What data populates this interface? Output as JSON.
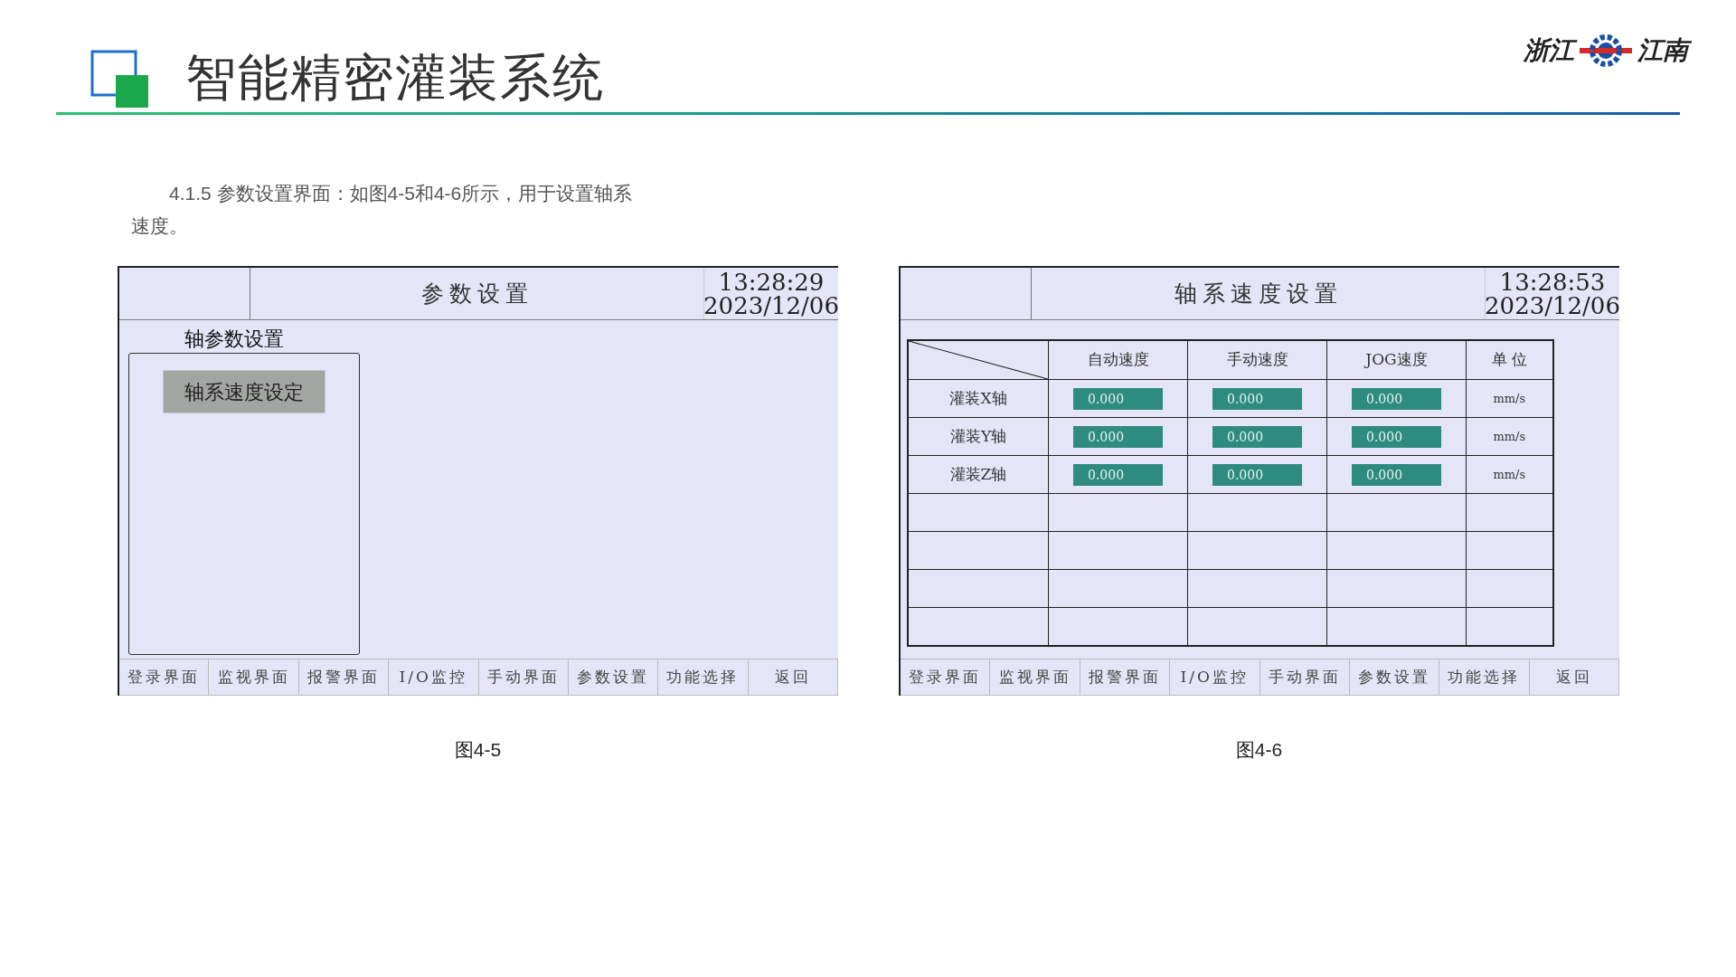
{
  "slide": {
    "title": "智能精密灌装系统",
    "logo": {
      "left_text": "浙江",
      "right_text": "江南"
    },
    "paragraph": "4.1.5  参数设置界面：如图4-5和4-6所示，用于设置轴系速度。"
  },
  "figures": [
    {
      "caption": "图4-5",
      "screen": {
        "kind": "menu",
        "title": "参数设置",
        "time": "13:28:29",
        "date": "2023/12/06",
        "group_label": "轴参数设置",
        "menu_buttons": [
          {
            "label": "轴系速度设定",
            "selected": true
          }
        ],
        "footer_buttons": [
          "登录界面",
          "监视界面",
          "报警界面",
          "I/O监控",
          "手动界面",
          "参数设置",
          "功能选择",
          "返回"
        ]
      }
    },
    {
      "caption": "图4-6",
      "screen": {
        "kind": "table",
        "title": "轴系速度设置",
        "time": "13:28:53",
        "date": "2023/12/06",
        "table": {
          "columns": [
            "自动速度",
            "手动速度",
            "JOG速度",
            "单 位"
          ],
          "rows": [
            {
              "kind": "axis",
              "label": "灌装X轴",
              "values": [
                "0.000",
                "0.000",
                "0.000"
              ],
              "unit": "mm/s"
            },
            {
              "kind": "axis",
              "label": "灌装Y轴",
              "values": [
                "0.000",
                "0.000",
                "0.000"
              ],
              "unit": "mm/s"
            },
            {
              "kind": "axis",
              "label": "灌装Z轴",
              "values": [
                "0.000",
                "0.000",
                "0.000"
              ],
              "unit": "mm/s"
            },
            {
              "kind": "blank"
            },
            {
              "kind": "blank"
            },
            {
              "kind": "blank"
            },
            {
              "kind": "blank"
            }
          ]
        },
        "footer_buttons": [
          "登录界面",
          "监视界面",
          "报警界面",
          "I/O监控",
          "手动界面",
          "参数设置",
          "功能选择",
          "返回"
        ]
      }
    }
  ]
}
